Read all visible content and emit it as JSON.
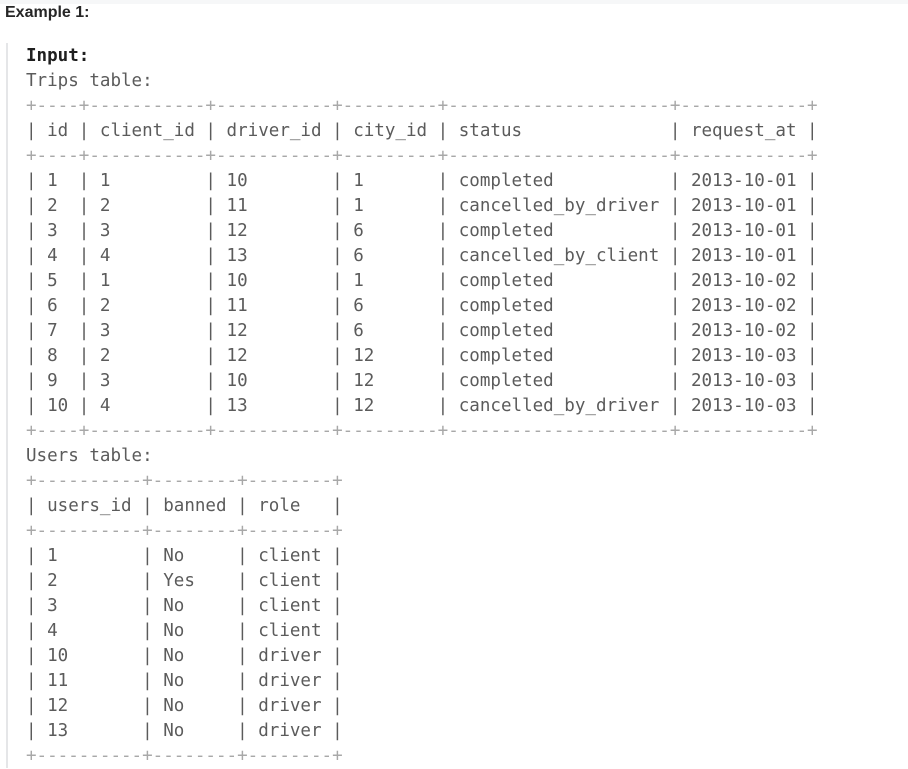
{
  "example": {
    "heading": "Example 1:"
  },
  "input_label": "Input:",
  "trips_table": {
    "title": "Trips table:",
    "border": "+----+-----------+-----------+---------+---------------------+------------+",
    "header": "| id | client_id | driver_id | city_id | status              | request_at |",
    "columns": [
      "id",
      "client_id",
      "driver_id",
      "city_id",
      "status",
      "request_at"
    ],
    "rows_text": [
      "| 1  | 1         | 10        | 1       | completed           | 2013-10-01 |",
      "| 2  | 2         | 11        | 1       | cancelled_by_driver | 2013-10-01 |",
      "| 3  | 3         | 12        | 6       | completed           | 2013-10-01 |",
      "| 4  | 4         | 13        | 6       | cancelled_by_client | 2013-10-01 |",
      "| 5  | 1         | 10        | 1       | completed           | 2013-10-02 |",
      "| 6  | 2         | 11        | 6       | completed           | 2013-10-02 |",
      "| 7  | 3         | 12        | 6       | completed           | 2013-10-02 |",
      "| 8  | 2         | 12        | 12      | completed           | 2013-10-03 |",
      "| 9  | 3         | 10        | 12      | completed           | 2013-10-03 |",
      "| 10 | 4         | 13        | 12      | cancelled_by_driver | 2013-10-03 |"
    ]
  },
  "users_table": {
    "title": "Users table:",
    "border": "+----------+--------+--------+",
    "header": "| users_id | banned | role   |",
    "columns": [
      "users_id",
      "banned",
      "role"
    ],
    "rows_text": [
      "| 1        | No     | client |",
      "| 2        | Yes    | client |",
      "| 3        | No     | client |",
      "| 4        | No     | client |",
      "| 10       | No     | driver |",
      "| 11       | No     | driver |",
      "| 12       | No     | driver |",
      "| 13       | No     | driver |"
    ]
  }
}
